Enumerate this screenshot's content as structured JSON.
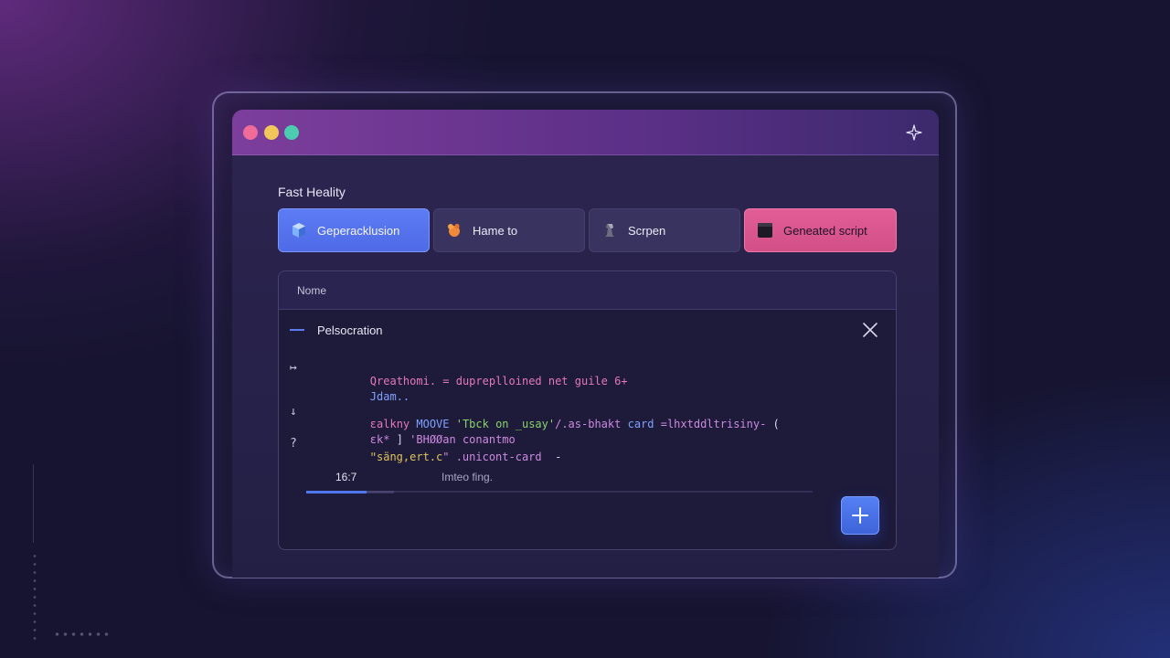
{
  "window": {
    "controls": [
      "close",
      "minimize",
      "maximize"
    ],
    "icon": "sparkle-icon"
  },
  "section_title": "Fast Heality",
  "tabs": [
    {
      "label": "Geperacklusion",
      "icon": "cube-icon",
      "state": "active",
      "color": "#5c7cf4"
    },
    {
      "label": "Hame to",
      "icon": "hand-icon",
      "state": "default"
    },
    {
      "label": "Scrpen",
      "icon": "chess-piece-icon",
      "state": "default"
    },
    {
      "label": "Geneated script",
      "icon": "black-square-icon",
      "state": "highlight",
      "color": "#e25d96"
    }
  ],
  "panel": {
    "header": "Nome",
    "row_title": "Pelsocration",
    "code_lines": [
      {
        "marker": "↦",
        "segments": [
          {
            "text": "Qreathomi. = dupreplloined net guile 6+",
            "color": "pink"
          }
        ]
      },
      {
        "marker": "",
        "segments": [
          {
            "text": "Jdam..",
            "color": "blue"
          }
        ]
      },
      {
        "marker": "↓",
        "segments": [
          {
            "text": "ɛalkny ",
            "color": "pink"
          },
          {
            "text": "MOOVE ",
            "color": "blue"
          },
          {
            "text": "'Tbck on _usay'",
            "color": "green"
          },
          {
            "text": "/.as-bhakt ",
            "color": "purple"
          },
          {
            "text": "card ",
            "color": "blue"
          },
          {
            "text": "=lhxtddltrisiny- ",
            "color": "purple"
          },
          {
            "text": "(",
            "color": "white"
          }
        ]
      },
      {
        "marker": "",
        "segments": [
          {
            "text": "ɛk* ",
            "color": "purple"
          },
          {
            "text": "] ",
            "color": "white"
          },
          {
            "text": "'BHØØan conantmo",
            "color": "purple"
          }
        ]
      },
      {
        "marker": "?",
        "segments": [
          {
            "text": "ʺsäng,ert.c",
            "color": "yellow"
          },
          {
            "text": "\" .unicont-card  ",
            "color": "purple"
          },
          {
            "text": "-",
            "color": "white"
          }
        ]
      }
    ],
    "time": "16:7",
    "status": "Imteo fing.",
    "progress": 0.12
  },
  "colors": {
    "accent": "#5c7cf4",
    "highlight": "#e25d96",
    "background": "#161430"
  }
}
